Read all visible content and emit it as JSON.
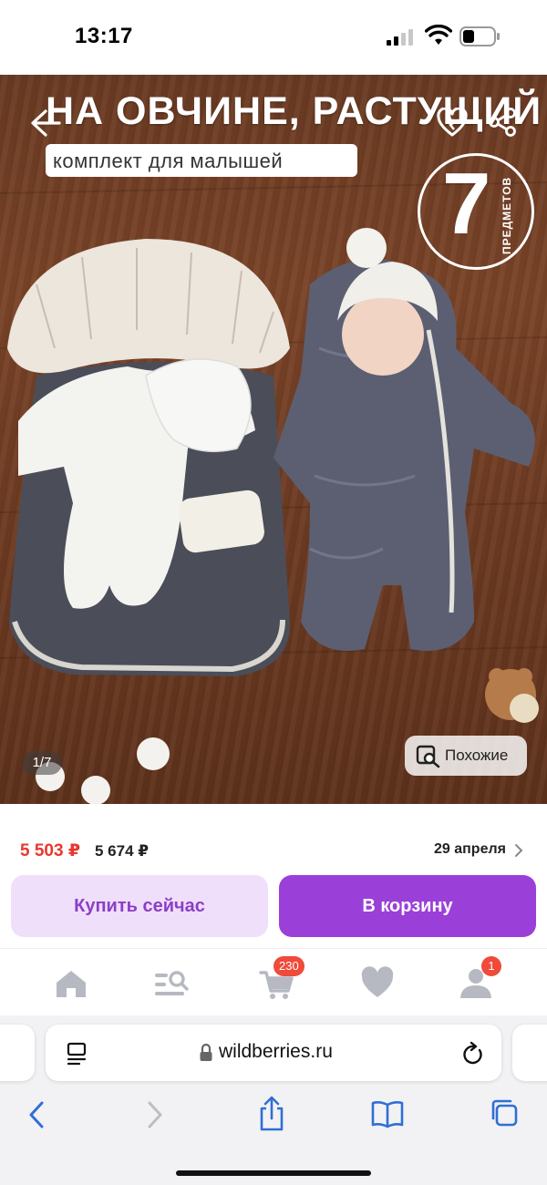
{
  "status_bar": {
    "time": "13:17"
  },
  "product_image": {
    "headline": "НА ОВЧИНЕ, РАСТУЩИЙ",
    "subheadline": "комплект для малышей",
    "badge_number": "7",
    "badge_text": "ПРЕДМЕТОВ",
    "counter": "1/7",
    "similar_label": "Похожие"
  },
  "price_panel": {
    "price": "5 503 ₽",
    "old_price": "5 674 ₽",
    "delivery_date": "29 апреля",
    "buy_now_label": "Купить сейчас",
    "add_to_cart_label": "В корзину"
  },
  "tab_bar": {
    "items": [
      {
        "name": "home",
        "icon": "home-icon"
      },
      {
        "name": "catalog",
        "icon": "catalog-search-icon"
      },
      {
        "name": "cart",
        "icon": "cart-icon",
        "badge": "230"
      },
      {
        "name": "favorites",
        "icon": "heart-icon"
      },
      {
        "name": "profile",
        "icon": "profile-icon",
        "badge": "1"
      }
    ]
  },
  "browser": {
    "url": "wildberries.ru"
  },
  "colors": {
    "price_red": "#e8382e",
    "brand_purple": "#9b3fd9",
    "buy_now_bg": "#f0dffa",
    "badge_red": "#ef4a3a",
    "tab_icon_gray": "#b7b9c2"
  }
}
